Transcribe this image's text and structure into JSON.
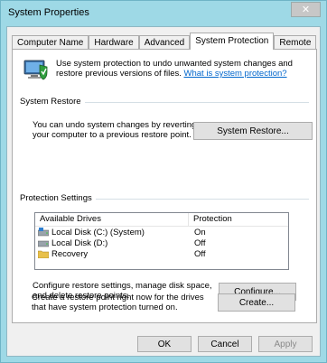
{
  "window": {
    "title": "System Properties",
    "close_glyph": "✕"
  },
  "tabs": [
    {
      "label": "Computer Name"
    },
    {
      "label": "Hardware"
    },
    {
      "label": "Advanced"
    },
    {
      "label": "System Protection"
    },
    {
      "label": "Remote"
    }
  ],
  "info": {
    "text": "Use system protection to undo unwanted system changes and restore previous versions of files.",
    "link": "What is system protection?"
  },
  "system_restore": {
    "group_label": "System Restore",
    "description": "You can undo system changes by reverting your computer to a previous restore point.",
    "button": "System Restore..."
  },
  "protection": {
    "group_label": "Protection Settings",
    "columns": [
      "Available Drives",
      "Protection"
    ],
    "drives": [
      {
        "name": "Local Disk (C:) (System)",
        "protection": "On",
        "icon": "system-drive-icon"
      },
      {
        "name": "Local Disk (D:)",
        "protection": "Off",
        "icon": "drive-icon"
      },
      {
        "name": "Recovery",
        "protection": "Off",
        "icon": "folder-drive-icon"
      }
    ],
    "configure_text": "Configure restore settings, manage disk space, and delete restore points.",
    "configure_button": "Configure...",
    "create_text": "Create a restore point right now for the drives that have system protection turned on.",
    "create_button": "Create..."
  },
  "footer": {
    "ok": "OK",
    "cancel": "Cancel",
    "apply": "Apply"
  }
}
